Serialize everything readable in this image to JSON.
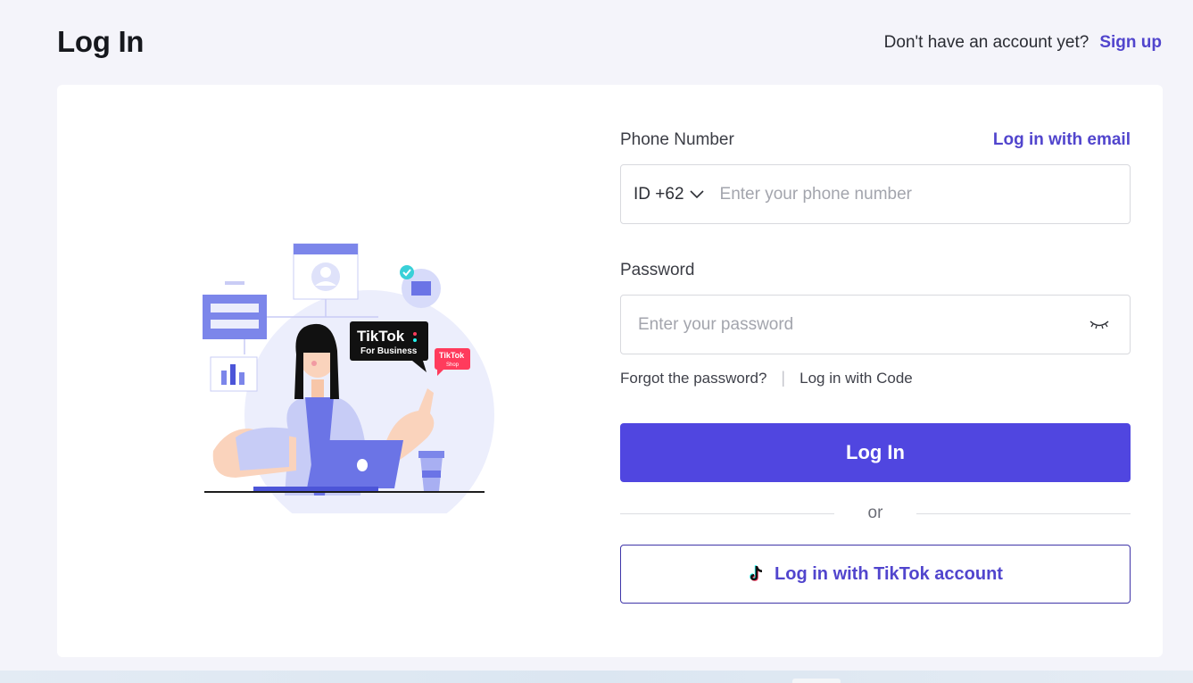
{
  "header": {
    "title": "Log In",
    "no_account_text": "Don't have an account yet?",
    "signup_label": "Sign up"
  },
  "illustration": {
    "brand_line1": "TikTok",
    "brand_line2": "For Business",
    "shop_line1": "TikTok",
    "shop_line2": "Shop"
  },
  "form": {
    "phone_label": "Phone Number",
    "email_link": "Log in with email",
    "country_code": "ID +62",
    "phone_placeholder": "Enter your phone number",
    "password_label": "Password",
    "password_placeholder": "Enter your password",
    "forgot_label": "Forgot the password?",
    "separator": "|",
    "code_label": "Log in with Code",
    "login_button": "Log In",
    "or_text": "or",
    "tiktok_button": "Log in with TikTok account"
  },
  "colors": {
    "accent": "#5046e0",
    "link": "#5145cd",
    "background": "#f4f4fa"
  }
}
